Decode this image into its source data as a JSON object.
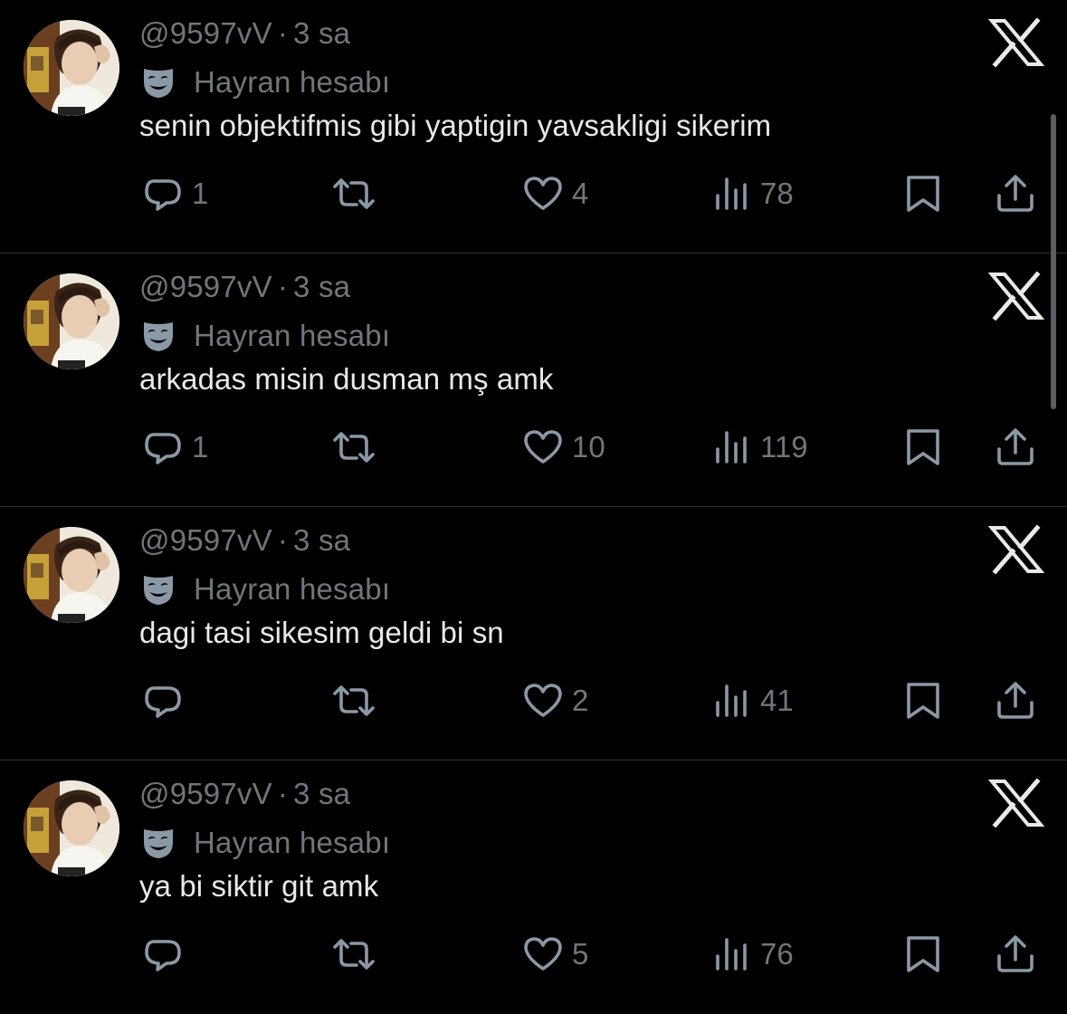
{
  "colors": {
    "background": "#000000",
    "text_primary": "#e7e9ea",
    "text_secondary": "#71767b",
    "divider": "#2f3336",
    "icon": "#8b98a5"
  },
  "icons": {
    "reply": "reply-bubble-icon",
    "retweet": "retweet-icon",
    "like": "heart-icon",
    "views": "views-bar-chart-icon",
    "bookmark": "bookmark-icon",
    "share": "share-upload-icon",
    "parody": "theater-mask-icon",
    "close": "x-logo-icon"
  },
  "tweets": [
    {
      "handle": "@9597vV",
      "separator": "·",
      "time": "3 sa",
      "label": "Hayran hesabı",
      "text": "senin objektifmis gibi yaptigin yavsakligi sikerim",
      "replies": "1",
      "likes": "4",
      "views": "78"
    },
    {
      "handle": "@9597vV",
      "separator": "·",
      "time": "3 sa",
      "label": "Hayran hesabı",
      "text": "arkadas misin dusman mş amk",
      "replies": "1",
      "likes": "10",
      "views": "119"
    },
    {
      "handle": "@9597vV",
      "separator": "·",
      "time": "3 sa",
      "label": "Hayran hesabı",
      "text": "dagi tasi sikesim geldi bi sn",
      "replies": "",
      "likes": "2",
      "views": "41"
    },
    {
      "handle": "@9597vV",
      "separator": "·",
      "time": "3 sa",
      "label": "Hayran hesabı",
      "text": "ya bi siktir git amk",
      "replies": "",
      "likes": "5",
      "views": "76"
    }
  ]
}
